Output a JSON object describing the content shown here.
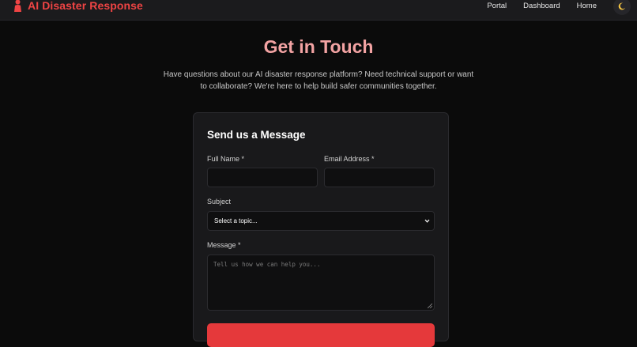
{
  "nav": {
    "brand": "AI Disaster Response",
    "links": [
      "Portal",
      "Dashboard",
      "Home"
    ],
    "theme_icon": "moon-icon",
    "brand_icon": "person-icon"
  },
  "hero": {
    "title": "Get in Touch",
    "subtitle": "Have questions about our AI disaster response platform? Need technical support or want to collaborate? We're here to help build safer communities together."
  },
  "form": {
    "title": "Send us a Message",
    "full_name_label": "Full Name *",
    "full_name_value": "",
    "email_label": "Email Address *",
    "email_value": "",
    "subject_label": "Subject",
    "subject_selected": "Select a topic...",
    "message_label": "Message *",
    "message_placeholder": "Tell us how we can help you..."
  },
  "colors": {
    "accent": "#ef4444",
    "title": "#f3a3a3",
    "background": "#0b0b0b",
    "card": "#19191b"
  }
}
